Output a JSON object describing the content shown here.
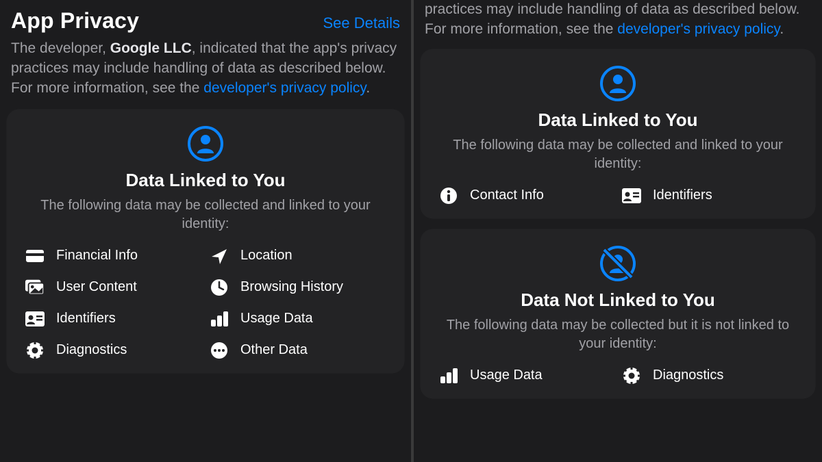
{
  "left": {
    "title": "App Privacy",
    "see_details": "See Details",
    "desc_prefix": "The developer, ",
    "developer": "Google LLC",
    "desc_mid": ", indicated that the app's privacy practices may include handling of data as described below. For more information, see the ",
    "policy_link": "developer's privacy policy",
    "desc_suffix": ".",
    "card": {
      "title": "Data Linked to You",
      "sub": "The following data may be collected and linked to your identity:",
      "items": [
        {
          "label": "Financial Info"
        },
        {
          "label": "Location"
        },
        {
          "label": "User Content"
        },
        {
          "label": "Browsing History"
        },
        {
          "label": "Identifiers"
        },
        {
          "label": "Usage Data"
        },
        {
          "label": "Diagnostics"
        },
        {
          "label": "Other Data"
        }
      ]
    }
  },
  "right": {
    "desc_prefix": "practices may include handling of data as described below. For more information, see the ",
    "policy_link": "developer's privacy policy",
    "desc_suffix": ".",
    "card_linked": {
      "title": "Data Linked to You",
      "sub": "The following data may be collected and linked to your identity:",
      "items": [
        {
          "label": "Contact Info"
        },
        {
          "label": "Identifiers"
        }
      ]
    },
    "card_notlinked": {
      "title": "Data Not Linked to You",
      "sub": "The following data may be collected but it is not linked to your identity:",
      "items": [
        {
          "label": "Usage Data"
        },
        {
          "label": "Diagnostics"
        }
      ]
    }
  }
}
